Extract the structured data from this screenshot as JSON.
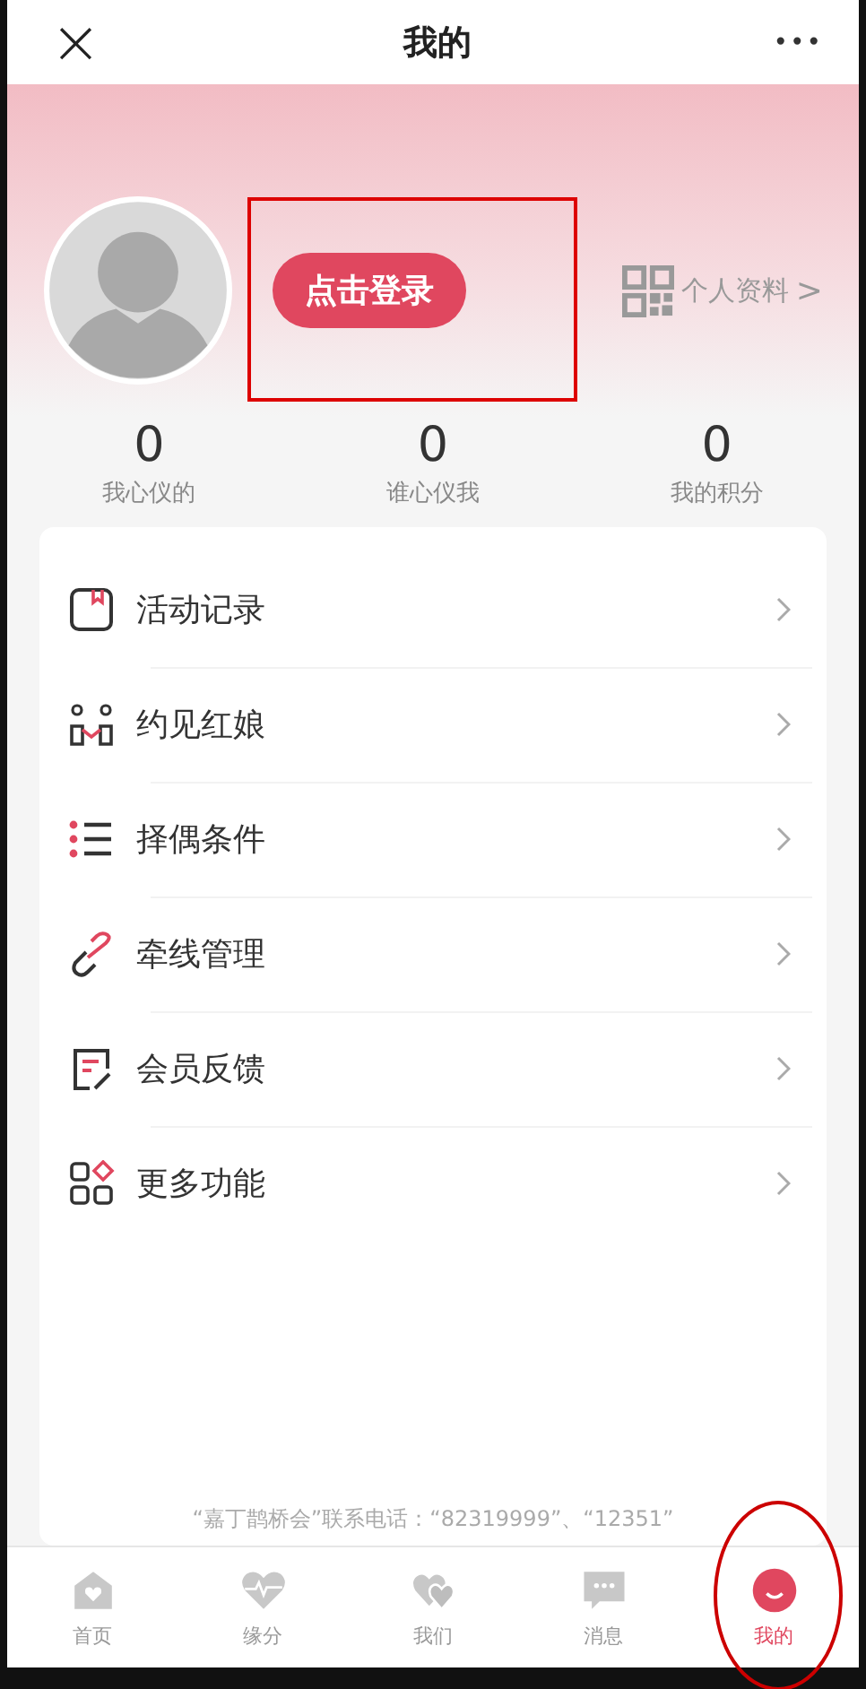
{
  "header": {
    "close": "×",
    "title": "我的",
    "more": "•••"
  },
  "profile": {
    "login": {
      "label": "点击登录",
      "boxed": true
    },
    "profile_link": "个人资料",
    "chevron": ">"
  },
  "stats": [
    {
      "value": "0",
      "label": "我心仪的"
    },
    {
      "value": "0",
      "label": "谁心仪我"
    },
    {
      "value": "0",
      "label": "我的积分"
    }
  ],
  "menu": [
    {
      "kind": "record",
      "label": "活动记录"
    },
    {
      "kind": "matchmaker",
      "label": "约见红娘"
    },
    {
      "kind": "criteria",
      "label": "择偶条件"
    },
    {
      "kind": "link",
      "label": "牵线管理"
    },
    {
      "kind": "feedback",
      "label": "会员反馈"
    },
    {
      "kind": "more",
      "label": "更多功能"
    }
  ],
  "footer_note": "“嘉丁鹊桥会”联系电话：“82319999”、“12351”",
  "tabs": [
    {
      "kind": "home",
      "label": "首页",
      "selected": false,
      "circled": false
    },
    {
      "kind": "heartbeat",
      "label": "缘分",
      "selected": false,
      "circled": false
    },
    {
      "kind": "hearts",
      "label": "我们",
      "selected": false,
      "circled": false
    },
    {
      "kind": "chat",
      "label": "消息",
      "selected": false,
      "circled": false
    },
    {
      "kind": "me",
      "label": "我的",
      "selected": true,
      "circled": true
    }
  ]
}
